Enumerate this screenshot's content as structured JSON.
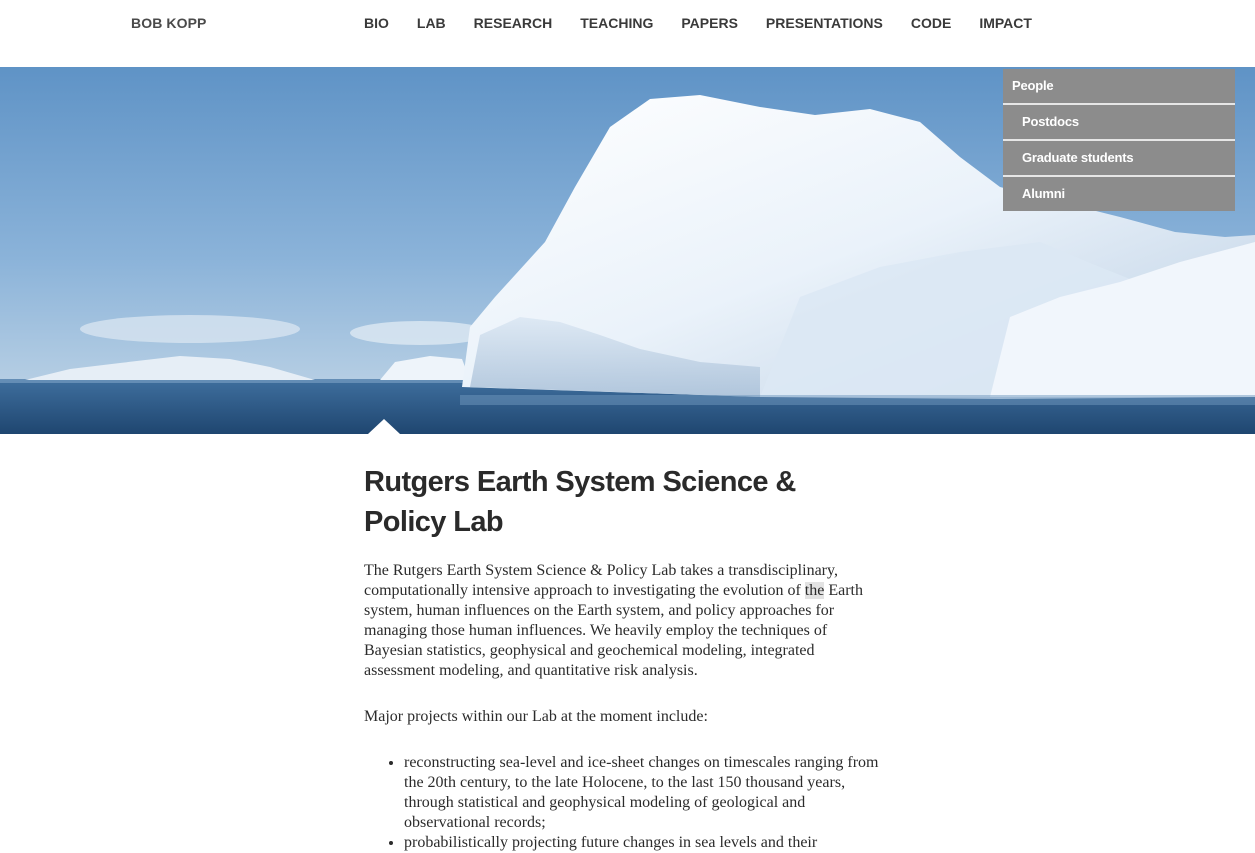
{
  "header": {
    "brand": "BOB KOPP",
    "nav": [
      "BIO",
      "LAB",
      "RESEARCH",
      "TEACHING",
      "PAPERS",
      "PRESENTATIONS",
      "CODE",
      "IMPACT"
    ]
  },
  "dropdown": {
    "items": [
      "People",
      "Postdocs",
      "Graduate students",
      "Alumni"
    ]
  },
  "main": {
    "title": "Rutgers Earth System Science & Policy Lab",
    "intro_before": "The Rutgers Earth System Science & Policy Lab takes a transdisciplinary, computationally intensive approach to investigating the evolution of ",
    "intro_highlight": "the",
    "intro_after": " Earth system, human influences on the Earth system, and policy approaches for managing those human influences. We heavily employ the techniques of Bayesian statistics, geophysical and geochemical modeling, integrated assessment modeling, and quantitative risk analysis.",
    "projects_intro": "Major projects within our Lab at the moment include:",
    "projects": [
      "reconstructing sea-level and ice-sheet changes on timescales ranging from the 20th century, to the late Holocene, to the last 150 thousand years, through statistical and geophysical modeling of geological and observational records;",
      "probabilistically projecting future changes in sea levels and their"
    ]
  },
  "colors": {
    "nav_text": "#3a3a3a",
    "dropdown_bg": "#8c8c8c",
    "dropdown_text": "#ffffff"
  }
}
